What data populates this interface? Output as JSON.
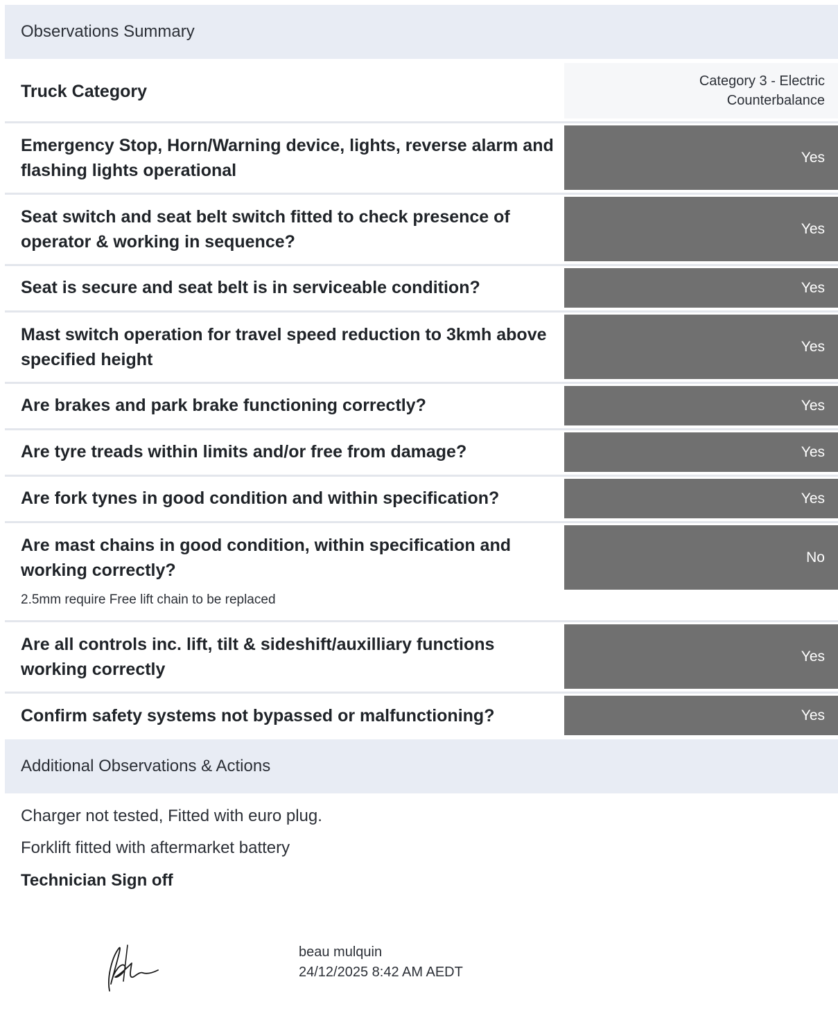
{
  "observations_summary": {
    "title": "Observations Summary",
    "truck_category": {
      "label": "Truck Category",
      "value_line1": "Category 3 - Electric",
      "value_line2": "Counterbalance"
    },
    "items": [
      {
        "question": "Emergency Stop, Horn/Warning device, lights, reverse alarm and flashing lights operational",
        "answer": "Yes"
      },
      {
        "question": "Seat switch and seat belt switch fitted to check presence of operator & working in sequence?",
        "answer": "Yes"
      },
      {
        "question": "Seat is secure and seat belt is in serviceable condition?",
        "answer": "Yes"
      },
      {
        "question": "Mast switch operation for travel speed reduction to 3kmh above specified height",
        "answer": "Yes"
      },
      {
        "question": "Are brakes and park brake functioning correctly?",
        "answer": "Yes"
      },
      {
        "question": "Are tyre treads within limits and/or free from damage?",
        "answer": "Yes"
      },
      {
        "question": "Are fork tynes in good condition and within specification?",
        "answer": "Yes"
      },
      {
        "question": "Are mast chains in good condition, within specification and working correctly?",
        "answer": "No",
        "note": "2.5mm require Free lift chain to be replaced"
      },
      {
        "question": "Are all controls inc. lift, tilt & sideshift/auxilliary functions working correctly",
        "answer": "Yes"
      },
      {
        "question": "Confirm safety systems not bypassed or malfunctioning?",
        "answer": "Yes"
      }
    ]
  },
  "additional": {
    "title": "Additional Observations & Actions",
    "lines": [
      "Charger not tested, Fitted with euro plug.",
      "Forklift fitted with aftermarket battery"
    ],
    "signoff_label": "Technician Sign off",
    "technician_name": "beau mulquin",
    "signed_at": "24/12/2025 8:42 AM AEDT",
    "signature_icon": "handwritten-signature"
  }
}
